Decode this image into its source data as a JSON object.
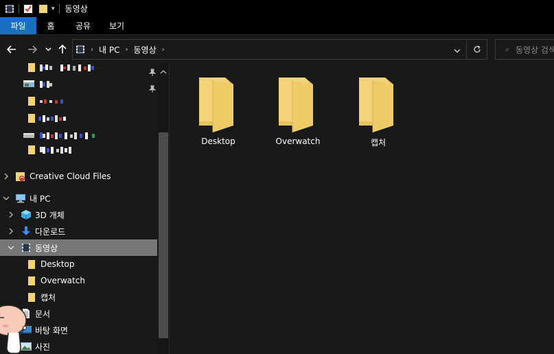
{
  "window": {
    "title": "동영상"
  },
  "ribbon": {
    "tabs": [
      "파일",
      "홈",
      "공유",
      "보기"
    ]
  },
  "address": {
    "segments": [
      "내 PC",
      "동영상"
    ]
  },
  "search": {
    "placeholder": "동영상 검색"
  },
  "nav": {
    "creative_cloud": "Creative Cloud Files",
    "this_pc": "내 PC",
    "objects_3d": "3D 개체",
    "downloads": "다운로드",
    "videos": "동영상",
    "videos_children": [
      "Desktop",
      "Overwatch",
      "캡처"
    ],
    "documents": "문서",
    "desktop": "바탕 화면",
    "pictures": "사진"
  },
  "content": {
    "items": [
      "Desktop",
      "Overwatch",
      "캡처"
    ]
  },
  "colors": {
    "accent": "#1a6fbf",
    "folder": "#f4d27a",
    "selection": "#777777"
  }
}
